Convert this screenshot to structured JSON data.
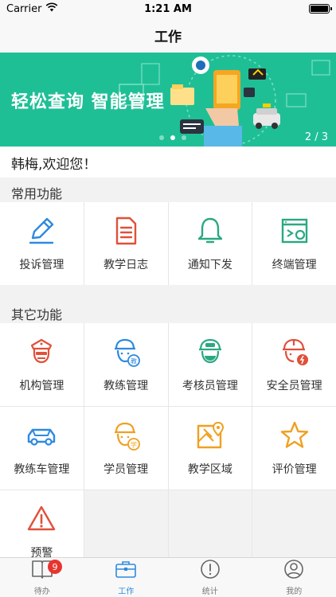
{
  "status": {
    "carrier": "Carrier",
    "time": "1:21 AM"
  },
  "nav": {
    "title": "工作"
  },
  "banner": {
    "headline": "轻松查询 智能管理",
    "page_indicator": "2 / 3",
    "bg_color": "#1fbf96"
  },
  "welcome": {
    "text": "韩梅,欢迎您！"
  },
  "common": {
    "title": "常用功能",
    "items": [
      {
        "label": "投诉管理",
        "icon": "pen-icon"
      },
      {
        "label": "教学日志",
        "icon": "document-icon"
      },
      {
        "label": "通知下发",
        "icon": "bell-icon"
      },
      {
        "label": "终端管理",
        "icon": "terminal-icon"
      }
    ]
  },
  "other": {
    "title": "其它功能",
    "items": [
      {
        "label": "机构管理",
        "icon": "officer-icon"
      },
      {
        "label": "教练管理",
        "icon": "coach-icon",
        "tag": "教"
      },
      {
        "label": "考核员管理",
        "icon": "examiner-icon"
      },
      {
        "label": "安全员管理",
        "icon": "safety-officer-icon"
      },
      {
        "label": "教练车管理",
        "icon": "car-icon"
      },
      {
        "label": "学员管理",
        "icon": "student-icon",
        "tag": "学"
      },
      {
        "label": "教学区域",
        "icon": "map-icon"
      },
      {
        "label": "评价管理",
        "icon": "star-icon"
      },
      {
        "label": "预警",
        "icon": "warning-icon"
      }
    ]
  },
  "tabs": [
    {
      "label": "待办",
      "icon": "book-icon",
      "badge": "9"
    },
    {
      "label": "工作",
      "icon": "briefcase-icon",
      "active": true
    },
    {
      "label": "统计",
      "icon": "alert-circle-icon"
    },
    {
      "label": "我的",
      "icon": "user-icon"
    }
  ],
  "colors": {
    "accent": "#2d8ae0",
    "blue": "#2d8ae0",
    "red": "#e0503a",
    "green": "#2aa882",
    "orange": "#f0a020",
    "badge": "#e8342f"
  }
}
